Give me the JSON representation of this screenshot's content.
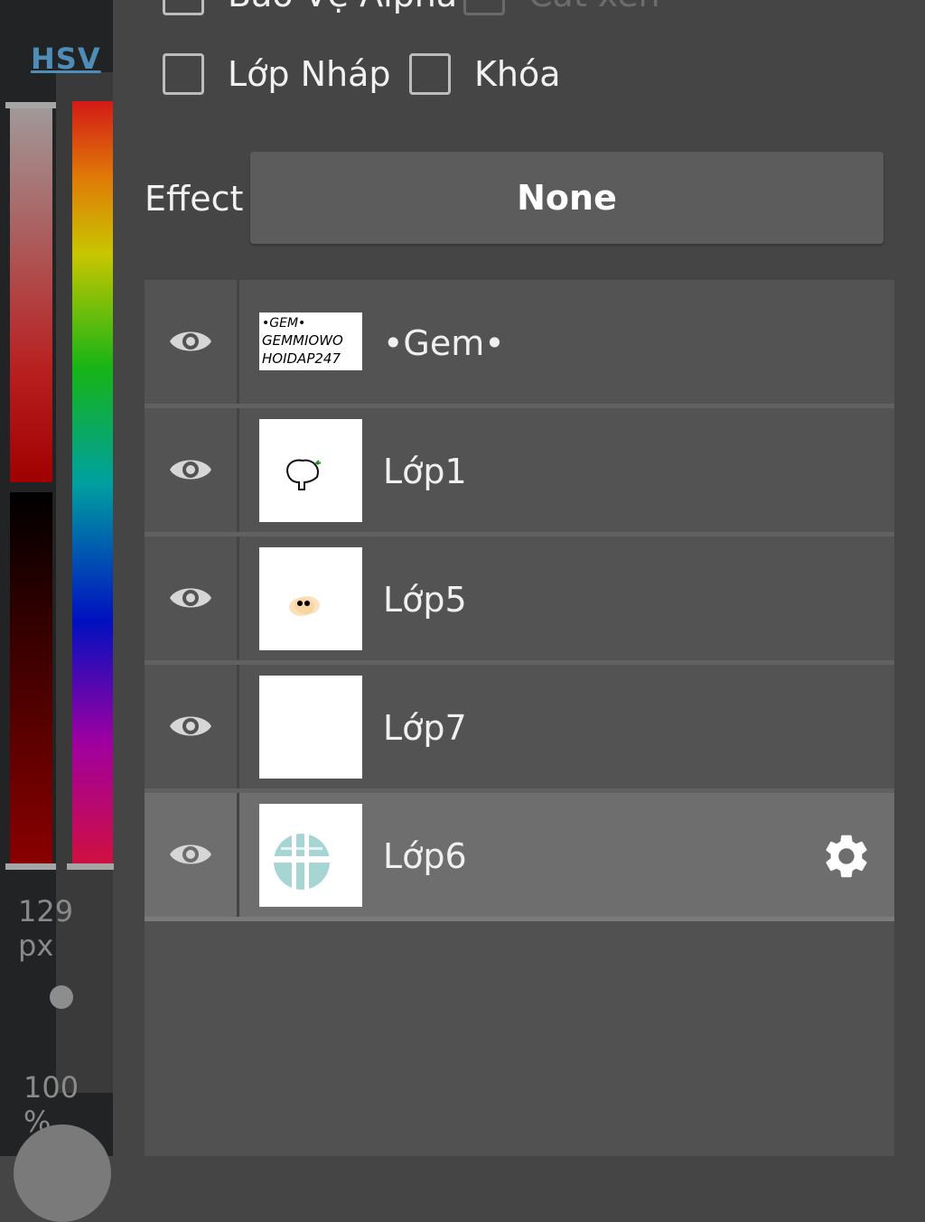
{
  "color_panel": {
    "mode_tab": "HSV",
    "brush_size": "129 px",
    "opacity": "100 %"
  },
  "options": {
    "row1": [
      {
        "label": "Bảo Vệ Alpha",
        "checked": false,
        "enabled": true
      },
      {
        "label": "Cắt xén",
        "checked": false,
        "enabled": false
      }
    ],
    "row2": [
      {
        "label": "Lớp Nháp",
        "checked": false,
        "enabled": true
      },
      {
        "label": "Khóa",
        "checked": false,
        "enabled": true
      }
    ]
  },
  "effect": {
    "label": "Effect",
    "value": "None"
  },
  "layers": [
    {
      "name": "•Gem•",
      "visible": true,
      "selected": false,
      "thumb_text": [
        "•GEM•",
        "GEMMIOWO",
        "HOIDAP247"
      ]
    },
    {
      "name": "Lớp1",
      "visible": true,
      "selected": false
    },
    {
      "name": "Lớp5",
      "visible": true,
      "selected": false
    },
    {
      "name": "Lớp7",
      "visible": true,
      "selected": false
    },
    {
      "name": "Lớp6",
      "visible": true,
      "selected": true
    }
  ],
  "icons": {
    "visibility": "eye-icon",
    "settings": "gear-icon"
  }
}
